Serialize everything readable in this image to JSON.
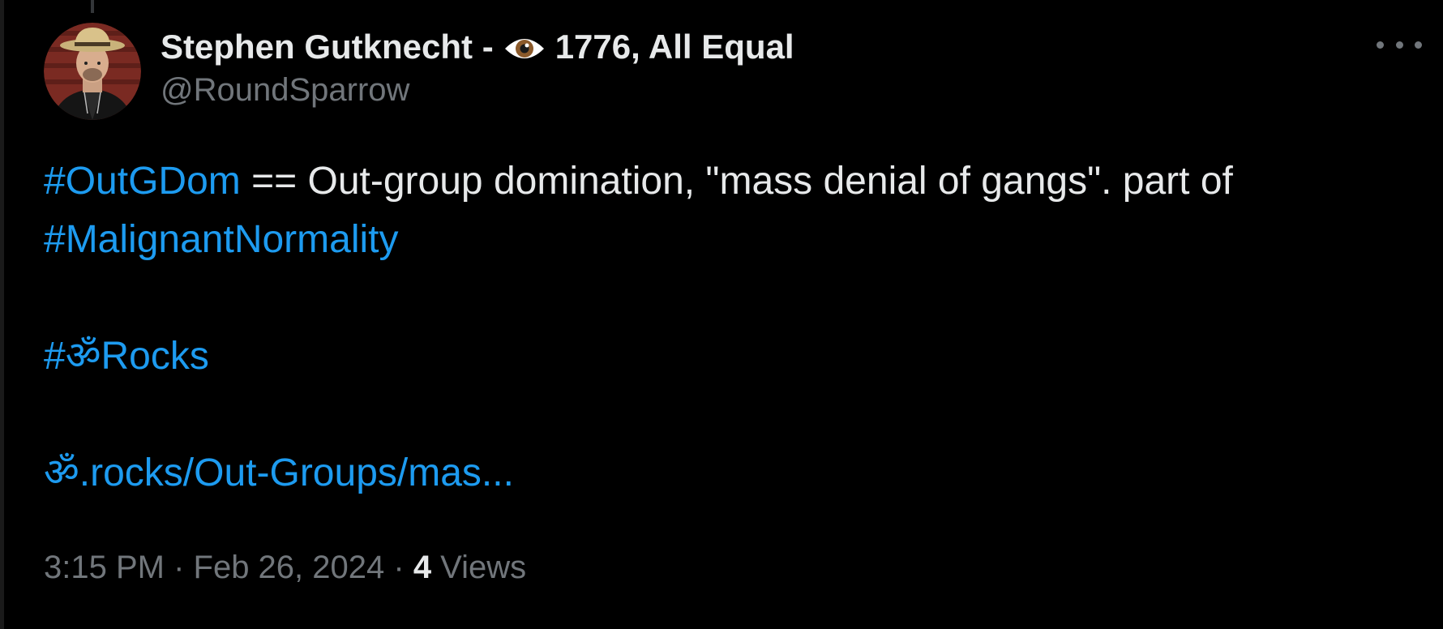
{
  "author": {
    "display_name_prefix": "Stephen Gutknecht -",
    "display_name_emoji": "eye-emoji",
    "display_name_suffix": "1776, All Equal",
    "handle": "@RoundSparrow",
    "avatar": "user-avatar-photo"
  },
  "tweet": {
    "line1": {
      "hashtag": "#OutGDom",
      "text": " == Out-group domination, \"mass denial of gangs\". part of"
    },
    "line2_hashtag": "#MalignantNormality",
    "line3_hashtag": "#ॐRocks",
    "link_text": "ॐ.rocks/Out-Groups/mas..."
  },
  "meta": {
    "time": "3:15 PM",
    "separator": " · ",
    "date": "Feb 26, 2024",
    "views_count": "4",
    "views_label": " Views"
  },
  "colors": {
    "background": "#000000",
    "text": "#e7e9ea",
    "secondary": "#71767b",
    "accent": "#1d9bf0"
  },
  "icons": {
    "more": "more-dots-icon"
  }
}
